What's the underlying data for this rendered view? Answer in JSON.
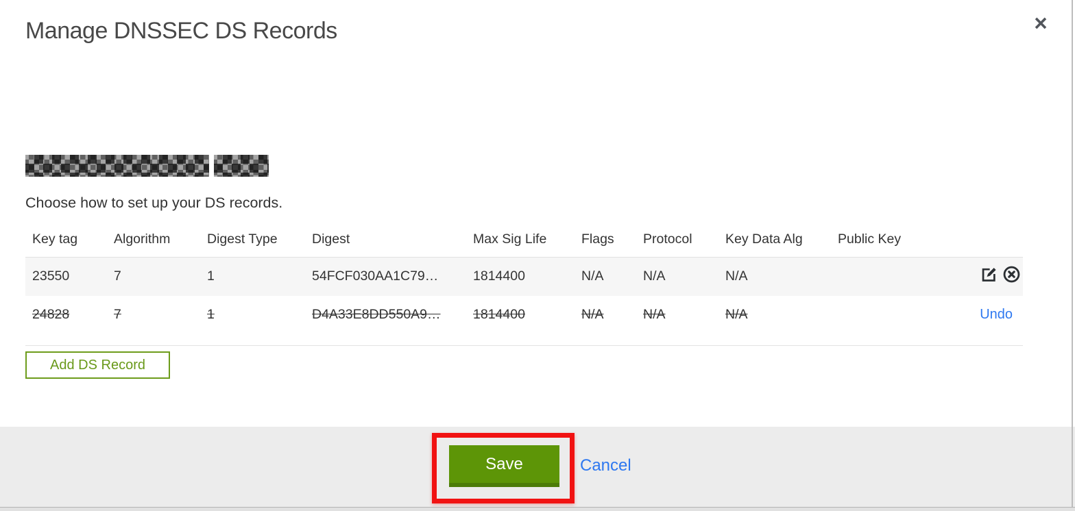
{
  "window": {
    "title": "Manage DNSSEC DS Records",
    "close_icon": "×"
  },
  "content": {
    "domain_redacted": true,
    "instruction": "Choose how to set up your DS records."
  },
  "table": {
    "columns": [
      "Key tag",
      "Algorithm",
      "Digest Type",
      "Digest",
      "Max Sig Life",
      "Flags",
      "Protocol",
      "Key Data Alg",
      "Public Key"
    ],
    "rows": [
      {
        "key_tag": "23550",
        "algorithm": "7",
        "digest_type": "1",
        "digest": "54FCF030AA1C79…",
        "max_sig_life": "1814400",
        "flags": "N/A",
        "protocol": "N/A",
        "key_data_alg": "N/A",
        "public_key": "",
        "state": "active"
      },
      {
        "key_tag": "24828",
        "algorithm": "7",
        "digest_type": "1",
        "digest": "D4A33E8DD550A9…",
        "max_sig_life": "1814400",
        "flags": "N/A",
        "protocol": "N/A",
        "key_data_alg": "N/A",
        "public_key": "",
        "state": "marked-for-deletion",
        "undo_label": "Undo"
      }
    ]
  },
  "buttons": {
    "add_ds_record": "Add DS Record",
    "save": "Save",
    "cancel": "Cancel"
  },
  "colors": {
    "primary_green": "#5d9507",
    "green_outline": "#6d9c1b",
    "link_blue": "#2e78f0",
    "annotation_red": "#f11212",
    "row_alt_bg": "#f6f6f6",
    "footer_bg": "#ececec"
  }
}
